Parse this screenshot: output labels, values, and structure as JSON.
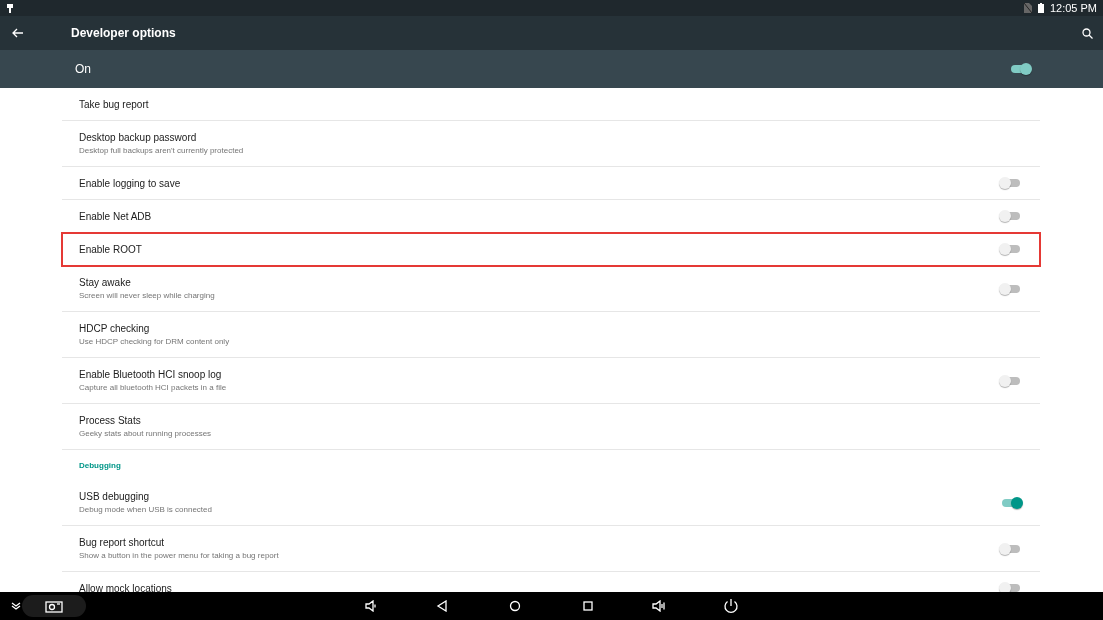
{
  "status_bar": {
    "time": "12:05 PM"
  },
  "toolbar": {
    "title": "Developer options"
  },
  "master_switch": {
    "label": "On",
    "on": true
  },
  "items": [
    {
      "kind": "setting",
      "title": "Take bug report"
    },
    {
      "kind": "setting",
      "title": "Desktop backup password",
      "summary": "Desktop full backups aren't currently protected"
    },
    {
      "kind": "toggle",
      "title": "Enable logging to save",
      "on": false
    },
    {
      "kind": "toggle",
      "title": "Enable Net ADB",
      "on": false
    },
    {
      "kind": "toggle",
      "title": "Enable ROOT",
      "on": false,
      "highlighted": true
    },
    {
      "kind": "toggle",
      "title": "Stay awake",
      "summary": "Screen will never sleep while charging",
      "on": false
    },
    {
      "kind": "setting",
      "title": "HDCP checking",
      "summary": "Use HDCP checking for DRM content only"
    },
    {
      "kind": "toggle",
      "title": "Enable Bluetooth HCI snoop log",
      "summary": "Capture all bluetooth HCI packets in a file",
      "on": false
    },
    {
      "kind": "setting",
      "title": "Process Stats",
      "summary": "Geeky stats about running processes"
    },
    {
      "kind": "header",
      "title": "Debugging"
    },
    {
      "kind": "toggle",
      "title": "USB debugging",
      "summary": "Debug mode when USB is connected",
      "on": true
    },
    {
      "kind": "toggle",
      "title": "Bug report shortcut",
      "summary": "Show a button in the power menu for taking a bug report",
      "on": false
    },
    {
      "kind": "toggle",
      "title": "Allow mock locations",
      "on": false
    }
  ]
}
